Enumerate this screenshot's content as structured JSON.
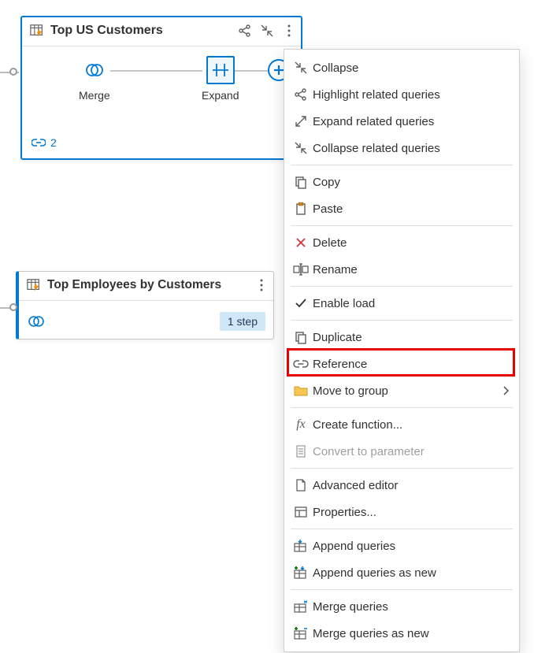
{
  "cards": {
    "top": {
      "title": "Top US Customers",
      "steps": [
        {
          "label": "Merge"
        },
        {
          "label": "Expand"
        }
      ],
      "references_count": "2"
    },
    "bottom": {
      "title": "Top Employees by Customers",
      "step_badge": "1 step"
    }
  },
  "menu": {
    "collapse": "Collapse",
    "highlight_related": "Highlight related queries",
    "expand_related": "Expand related queries",
    "collapse_related": "Collapse related queries",
    "copy": "Copy",
    "paste": "Paste",
    "delete": "Delete",
    "rename": "Rename",
    "enable_load": "Enable load",
    "duplicate": "Duplicate",
    "reference": "Reference",
    "move_to_group": "Move to group",
    "create_function": "Create function...",
    "convert_to_parameter": "Convert to parameter",
    "advanced_editor": "Advanced editor",
    "properties": "Properties...",
    "append_queries": "Append queries",
    "append_queries_as_new": "Append queries as new",
    "merge_queries": "Merge queries",
    "merge_queries_as_new": "Merge queries as new"
  },
  "highlighted_item": "reference"
}
